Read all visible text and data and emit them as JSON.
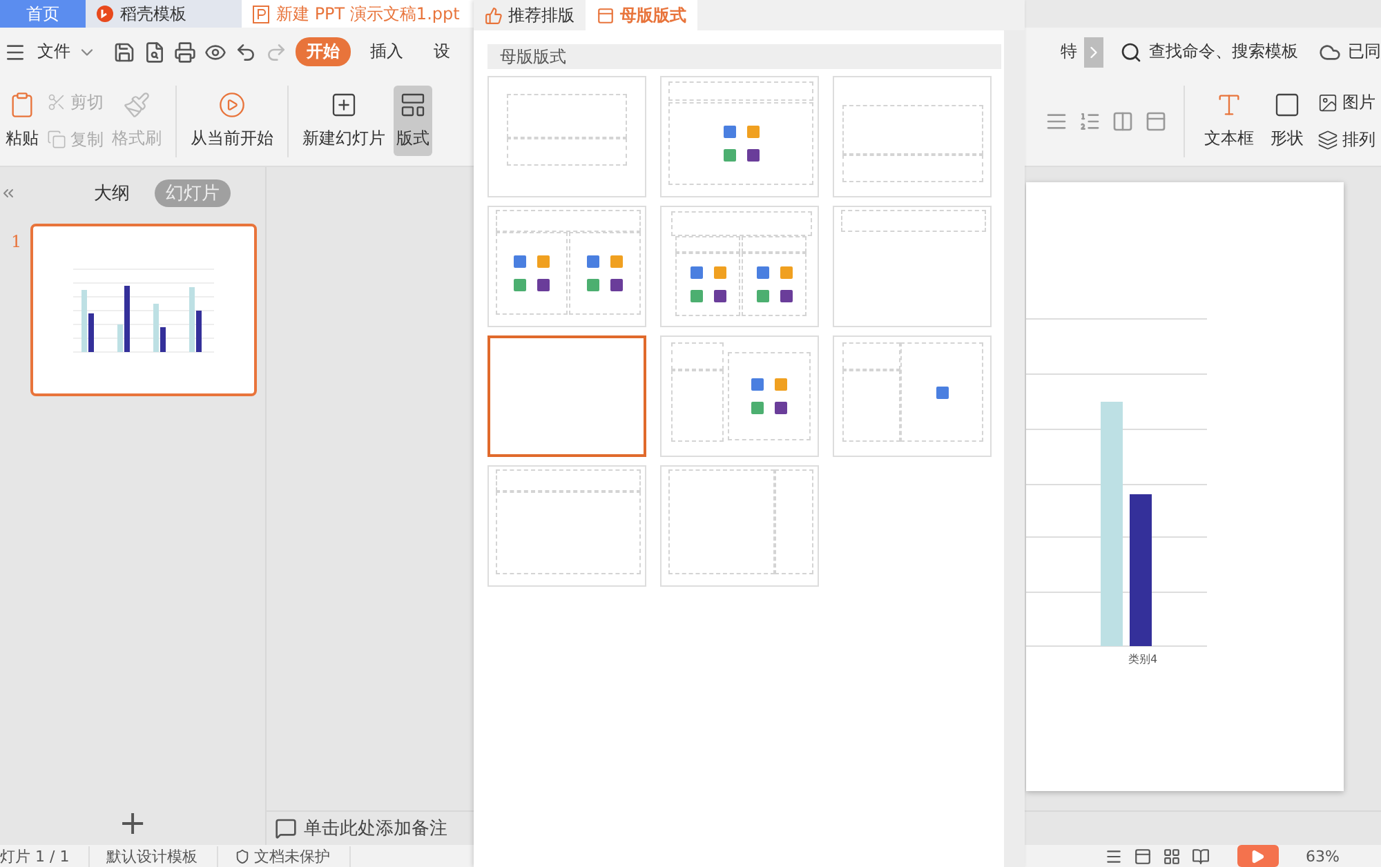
{
  "doc_tabs": [
    {
      "label": "首页",
      "kind": "home",
      "selected": false
    },
    {
      "label": "稻壳模板",
      "kind": "docer",
      "selected": false
    },
    {
      "label": "新建 PPT 演示文稿1.ppt",
      "kind": "ppt",
      "selected": true
    }
  ],
  "menu": {
    "file": "文件",
    "tabs": [
      {
        "label": "开始",
        "selected": true
      },
      {
        "label": "插入",
        "selected": false
      },
      {
        "label": "设",
        "selected": false
      }
    ],
    "more": "特",
    "search": "查找命令、搜索模板",
    "sync": "已同"
  },
  "ribbon_left": [
    {
      "label": "粘贴",
      "kind": "large",
      "disabled": false,
      "selected": false
    },
    {
      "label": "剪切",
      "kind": "small",
      "disabled": true,
      "selected": false
    },
    {
      "label": "复制",
      "kind": "small",
      "disabled": true,
      "selected": false
    },
    {
      "label": "格式刷",
      "kind": "large",
      "disabled": true,
      "selected": false
    },
    {
      "label": "从当前开始",
      "kind": "large",
      "disabled": false,
      "selected": false
    },
    {
      "label": "新建幻灯片",
      "kind": "large",
      "disabled": false,
      "selected": false
    },
    {
      "label": "版式",
      "kind": "large",
      "disabled": false,
      "selected": true
    }
  ],
  "ribbon_right": [
    {
      "label": "文本框",
      "kind": "large"
    },
    {
      "label": "形状",
      "kind": "large"
    },
    {
      "label": "图片",
      "kind": "small"
    },
    {
      "label": "排列",
      "kind": "small"
    }
  ],
  "left_panel": {
    "view_tabs": [
      {
        "label": "大纲",
        "selected": false
      },
      {
        "label": "幻灯片",
        "selected": true
      }
    ],
    "slides": [
      {
        "number": "1",
        "selected": true
      }
    ],
    "add": "+"
  },
  "notes": {
    "placeholder": "单击此处添加备注"
  },
  "slide": {
    "category": "类别4"
  },
  "status_bar": {
    "items": [
      "灯片 1 / 1",
      "默认设计模板",
      "文档未保护"
    ],
    "zoom": "63%"
  },
  "layout_panel": {
    "tabs": [
      {
        "label": "推荐排版",
        "selected": false
      },
      {
        "label": "母版版式",
        "selected": true
      }
    ],
    "heading": "母版版式",
    "layouts": [
      {
        "kind": "title",
        "selected": false
      },
      {
        "kind": "title-content",
        "selected": false
      },
      {
        "kind": "section",
        "selected": false
      },
      {
        "kind": "two-content",
        "selected": false
      },
      {
        "kind": "comparison",
        "selected": false
      },
      {
        "kind": "title-only",
        "selected": false
      },
      {
        "kind": "blank",
        "selected": true
      },
      {
        "kind": "content-caption",
        "selected": false
      },
      {
        "kind": "picture-caption",
        "selected": false
      },
      {
        "kind": "title-body",
        "selected": false
      },
      {
        "kind": "vertical",
        "selected": false
      }
    ]
  }
}
